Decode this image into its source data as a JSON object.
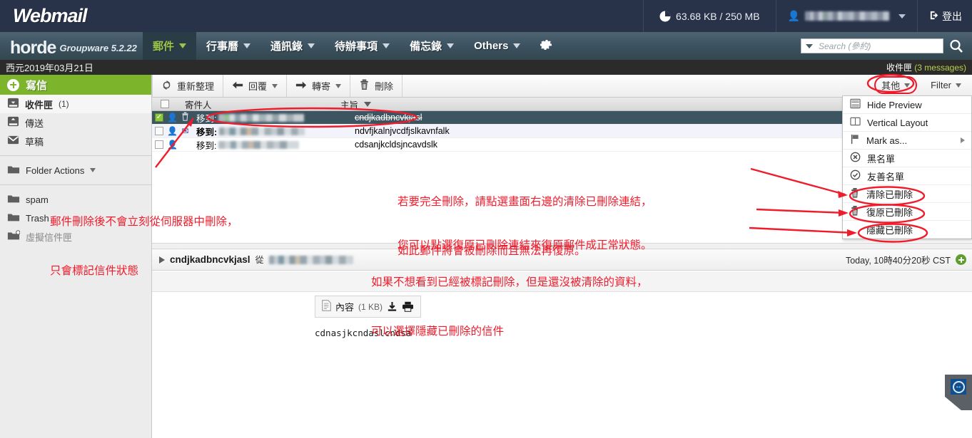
{
  "topbar": {
    "logo": "Webmail",
    "quota": "63.68 KB / 250 MB",
    "quota_icon": "pie-chart-icon",
    "user_icon": "person-icon",
    "user_email_redacted": "",
    "logout_label": "登出",
    "logout_icon": "logout-icon"
  },
  "hordebar": {
    "brand": "horde",
    "brand_sub": "Groupware 5.2.22",
    "menu": [
      {
        "label": "郵件",
        "active": true
      },
      {
        "label": "行事曆",
        "active": false
      },
      {
        "label": "通訊錄",
        "active": false
      },
      {
        "label": "待辦事項",
        "active": false
      },
      {
        "label": "備忘錄",
        "active": false
      },
      {
        "label": "Others",
        "active": false
      }
    ],
    "gear_icon": "gear-icon",
    "search": {
      "placeholder": "Search (參約)",
      "value": "",
      "search_icon": "search-icon",
      "dropdown_icon": "chevron-down-icon"
    }
  },
  "datestrip": {
    "date": "西元2019年03月21日",
    "folder_label": "收件匣",
    "folder_count": "(3 messages)"
  },
  "sidebar": {
    "compose_label": "寫信",
    "items": [
      {
        "label": "收件匣",
        "count": "(1)",
        "icon": "inbox-icon",
        "selected": true,
        "muted": false
      },
      {
        "label": "傳送",
        "count": "",
        "icon": "sent-icon",
        "selected": false,
        "muted": false
      },
      {
        "label": "草稿",
        "count": "",
        "icon": "draft-icon",
        "selected": false,
        "muted": false
      }
    ],
    "folder_actions": {
      "label": "Folder Actions",
      "icon": "folder-icon"
    },
    "folders": [
      {
        "label": "spam",
        "icon": "folder-icon",
        "muted": false
      },
      {
        "label": "Trash",
        "icon": "folder-icon",
        "muted": false
      },
      {
        "label": "虛擬信件匣",
        "icon": "folder-add-icon",
        "muted": true
      }
    ]
  },
  "toolbar": {
    "refresh_label": "重新整理",
    "refresh_icon": "refresh-icon",
    "reply_label": "回覆",
    "reply_icon": "arrow-left-icon",
    "forward_label": "轉寄",
    "forward_icon": "arrow-right-icon",
    "delete_label": "刪除",
    "delete_icon": "trash-icon"
  },
  "columns": {
    "from": "寄件人",
    "subject": "主旨"
  },
  "messages": [
    {
      "checked": true,
      "status_icon": "trash-icon",
      "person_icon": "person-icon",
      "from_prefix": "移到:",
      "from_bold": false,
      "subject": "cndjkadbncvkjasl",
      "deleted": true,
      "selected": true,
      "unread": false
    },
    {
      "checked": false,
      "status_icon": "envelope-icon",
      "person_icon": "person-icon",
      "from_prefix": "移到:",
      "from_bold": true,
      "subject": "ndvfjkalnjvcdfjslkavnfalk",
      "deleted": false,
      "selected": false,
      "unread": true
    },
    {
      "checked": false,
      "status_icon": "",
      "person_icon": "person-icon",
      "from_prefix": "移到:",
      "from_bold": false,
      "subject": "cdsanjkcldsjncavdslk",
      "deleted": false,
      "selected": false,
      "unread": false
    }
  ],
  "preview": {
    "expand_icon": "triangle-right-icon",
    "subject": "cndjkadbncvkjasl",
    "from_label": "從",
    "timestamp": "Today, 10時40分20秒 CST",
    "add_icon": "plus-circle-icon",
    "attachment": {
      "name": "內容",
      "size": "(1 KB)",
      "file_icon": "document-icon",
      "download_icon": "download-icon",
      "print_icon": "printer-icon"
    },
    "body": "cdnasjkcndaslcndsa"
  },
  "right_panel": {
    "other_button": "其他",
    "filter_button": "Filter",
    "menu_items": [
      {
        "label": "Hide Preview",
        "icon": "preview-pane-icon",
        "submenu": false,
        "highlighted": false
      },
      {
        "label": "Vertical Layout",
        "icon": "columns-icon",
        "submenu": false,
        "highlighted": false
      },
      {
        "label": "Mark as...",
        "icon": "flag-icon",
        "submenu": true,
        "highlighted": false
      },
      {
        "label": "黑名單",
        "icon": "blocklist-icon",
        "submenu": false,
        "highlighted": false
      },
      {
        "label": "友善名單",
        "icon": "allowlist-icon",
        "submenu": false,
        "highlighted": false
      },
      {
        "label": "清除已刪除",
        "icon": "trash-icon",
        "submenu": false,
        "highlighted": true
      },
      {
        "label": "復原已刪除",
        "icon": "trash-icon",
        "submenu": false,
        "highlighted": true
      },
      {
        "label": "隱藏已刪除",
        "icon": "",
        "submenu": false,
        "highlighted": true
      }
    ]
  },
  "annotations": {
    "accent_color": "#f01c2c",
    "left_note_line1": "郵件刪除後不會立刻從伺服器中刪除，",
    "left_note_line2": "只會標記信件狀態",
    "purge_note_line1": "若要完全刪除，請點選畫面右邊的清除已刪除連結，",
    "purge_note_line2": "如此郵件將會被刪除而且無法再復原。",
    "undelete_note": "您可以點選復原已刪除連結來復原郵件成正常狀態。",
    "hide_note_line1": "如果不想看到已經被標記刪除，但是還沒被清除的資料，",
    "hide_note_line2": "可以選擇隱藏已刪除的信件"
  },
  "tv_widget": {
    "icon": "resize-arrows-icon"
  }
}
